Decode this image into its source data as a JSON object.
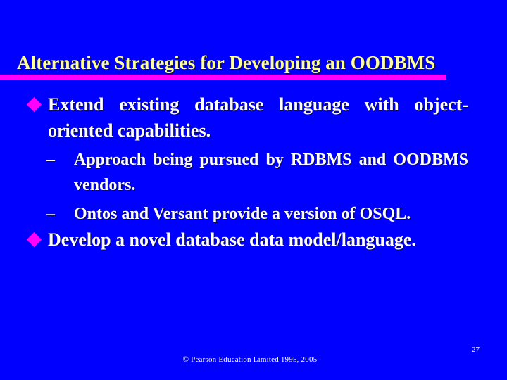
{
  "slide": {
    "background_color": "#0000FF",
    "title": {
      "text": "Alternative Strategies for Developing an OODBMS",
      "color": "#FFFF99",
      "rule_color": "#FF00FF"
    },
    "bullets": [
      {
        "level": 1,
        "marker": "diamond-bullet",
        "marker_color": "#FF00FF",
        "text": "Extend existing database language with object-oriented capabilities."
      },
      {
        "level": 2,
        "marker": "–",
        "text": "Approach being pursued by RDBMS and OODBMS vendors."
      },
      {
        "level": 2,
        "marker": "–",
        "text": "Ontos and Versant provide a version of OSQL."
      },
      {
        "level": 1,
        "marker": "diamond-bullet",
        "marker_color": "#FF00FF",
        "text": "Develop a novel database data model/language."
      }
    ],
    "footer": {
      "copyright": "© Pearson Education Limited 1995, 2005",
      "page_number": "27"
    }
  }
}
